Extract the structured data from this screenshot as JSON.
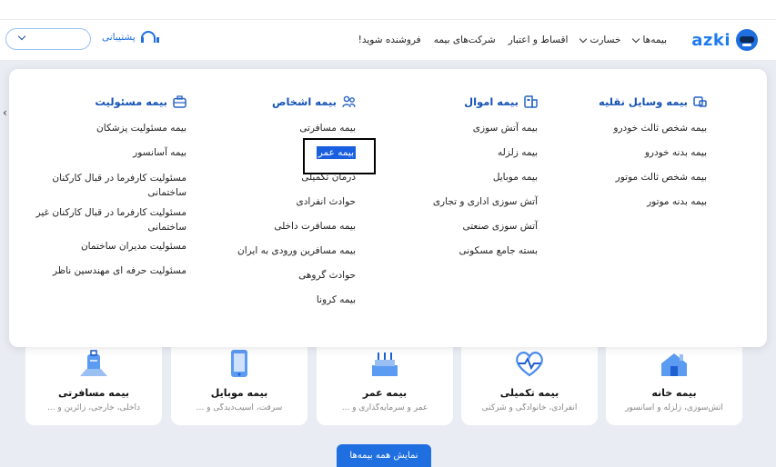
{
  "header": {
    "logo_text": "azki",
    "nav": [
      {
        "label": "بیمه‌ها",
        "has_chevron": true
      },
      {
        "label": "خسارت",
        "has_chevron": true
      },
      {
        "label": "اقساط و اعتبار",
        "has_chevron": false
      },
      {
        "label": "شرکت‌های بیمه",
        "has_chevron": false
      },
      {
        "label": "فروشنده شوید!",
        "has_chevron": false
      }
    ],
    "support_label": "پشتیبانی",
    "accent_color": "#1f6fe0"
  },
  "menu": {
    "columns": [
      {
        "title": "بیمه وسایل نقلیه",
        "icon": "vehicle-icon",
        "items": [
          "بیمه شخص ثالث خودرو",
          "بیمه بدنه خودرو",
          "بیمه شخص ثالث موتور",
          "بیمه بدنه موتور"
        ]
      },
      {
        "title": "بیمه اموال",
        "icon": "building-icon",
        "items": [
          "بیمه آتش سوزی",
          "بیمه زلزله",
          "بیمه موبایل",
          "آتش سوزی اداری و تجاری",
          "آتش سوزی صنعتی",
          "بسته جامع مسکونی"
        ]
      },
      {
        "title": "بیمه اشخاص",
        "icon": "people-icon",
        "items": [
          "بیمه مسافرتی",
          "بیمه عمر",
          "درمان تکمیلی",
          "حوادث انفرادی",
          "بیمه مسافرت داخلی",
          "بیمه مسافرین ورودی به ایران",
          "حوادث گروهی",
          "بیمه کرونا"
        ]
      },
      {
        "title": "بیمه مسئولیت",
        "icon": "briefcase-icon",
        "items": [
          "بیمه مسئولیت پزشکان",
          "بیمه آسانسور",
          "مسئولیت کارفرما در قبال کارکنان ساختمانی",
          "مسئولیت کارفرما در قبال کارکنان غیر ساختمانی",
          "مسئولیت مدیران ساختمان",
          "مسئولیت حرفه ای مهندسین ناظر"
        ]
      }
    ]
  },
  "cards": [
    {
      "title": "بیمه خانه",
      "subtitle": "آتش‌سوزی، زلزله و آسانسور",
      "icon": "house-icon"
    },
    {
      "title": "بیمه تکمیلی",
      "subtitle": "انفرادی، خانوادگی و شرکتی",
      "icon": "heart-pulse-icon"
    },
    {
      "title": "بیمه عمر",
      "subtitle": "عمر و سرمایه‌گذاری و ...",
      "icon": "cake-icon"
    },
    {
      "title": "بیمه موبایل",
      "subtitle": "سرقت، آسیب‌دیدگی و ...",
      "icon": "mobile-icon"
    },
    {
      "title": "بیمه مسافرتی",
      "subtitle": "داخلی، خارجی، زائرین و ...",
      "icon": "suitcase-icon"
    }
  ],
  "show_all_label": "نمایش همه بیمه‌ها"
}
